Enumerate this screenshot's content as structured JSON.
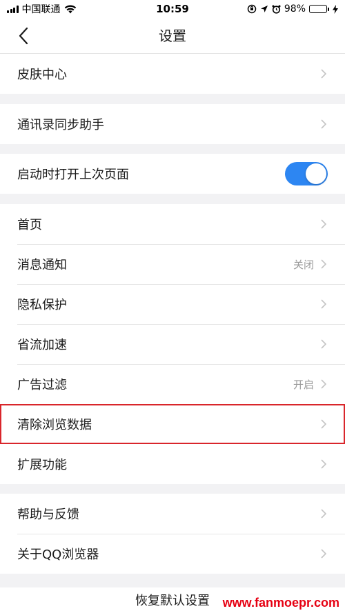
{
  "status_bar": {
    "carrier": "中国联通",
    "time": "10:59",
    "battery_percent": "98%",
    "battery_level": 0.98,
    "battery_color": "#4cd964"
  },
  "nav": {
    "title": "设置",
    "back_icon": "chevron-left-icon"
  },
  "groups": {
    "skin": [
      {
        "label": "皮肤中心"
      }
    ],
    "contacts": [
      {
        "label": "通讯录同步助手"
      }
    ],
    "startup": [
      {
        "label": "启动时打开上次页面",
        "toggle_on": true,
        "toggle_color": "#2d86f2"
      }
    ],
    "main": [
      {
        "label": "首页",
        "value": ""
      },
      {
        "label": "消息通知",
        "value": "关闭"
      },
      {
        "label": "隐私保护",
        "value": ""
      },
      {
        "label": "省流加速",
        "value": ""
      },
      {
        "label": "广告过滤",
        "value": "开启"
      },
      {
        "label": "清除浏览数据",
        "value": "",
        "highlighted": true,
        "highlight_color": "#d9262b"
      },
      {
        "label": "扩展功能",
        "value": ""
      }
    ],
    "help": [
      {
        "label": "帮助与反馈"
      },
      {
        "label": "关于QQ浏览器"
      }
    ]
  },
  "restore_label": "恢复默认设置",
  "watermark": "www.fanmoepr.com"
}
